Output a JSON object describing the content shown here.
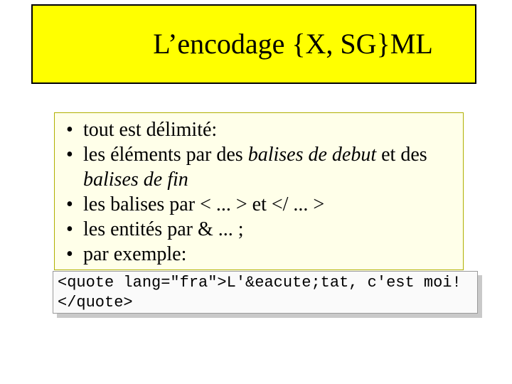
{
  "title": "L’encodage {X, SG}ML",
  "bullets": {
    "b1": "tout est délimité:",
    "b2_a": "les éléments par des ",
    "b2_b": "balises de debut",
    "b2_c": " et des ",
    "b2_d": "balises de fin",
    "b3": "les balises par < ... > et </ ... >",
    "b4": "les entités par & ... ;",
    "b5": "par exemple:"
  },
  "code": "<quote lang=\"fra\">L'&eacute;tat, c'est moi!\n</quote>"
}
